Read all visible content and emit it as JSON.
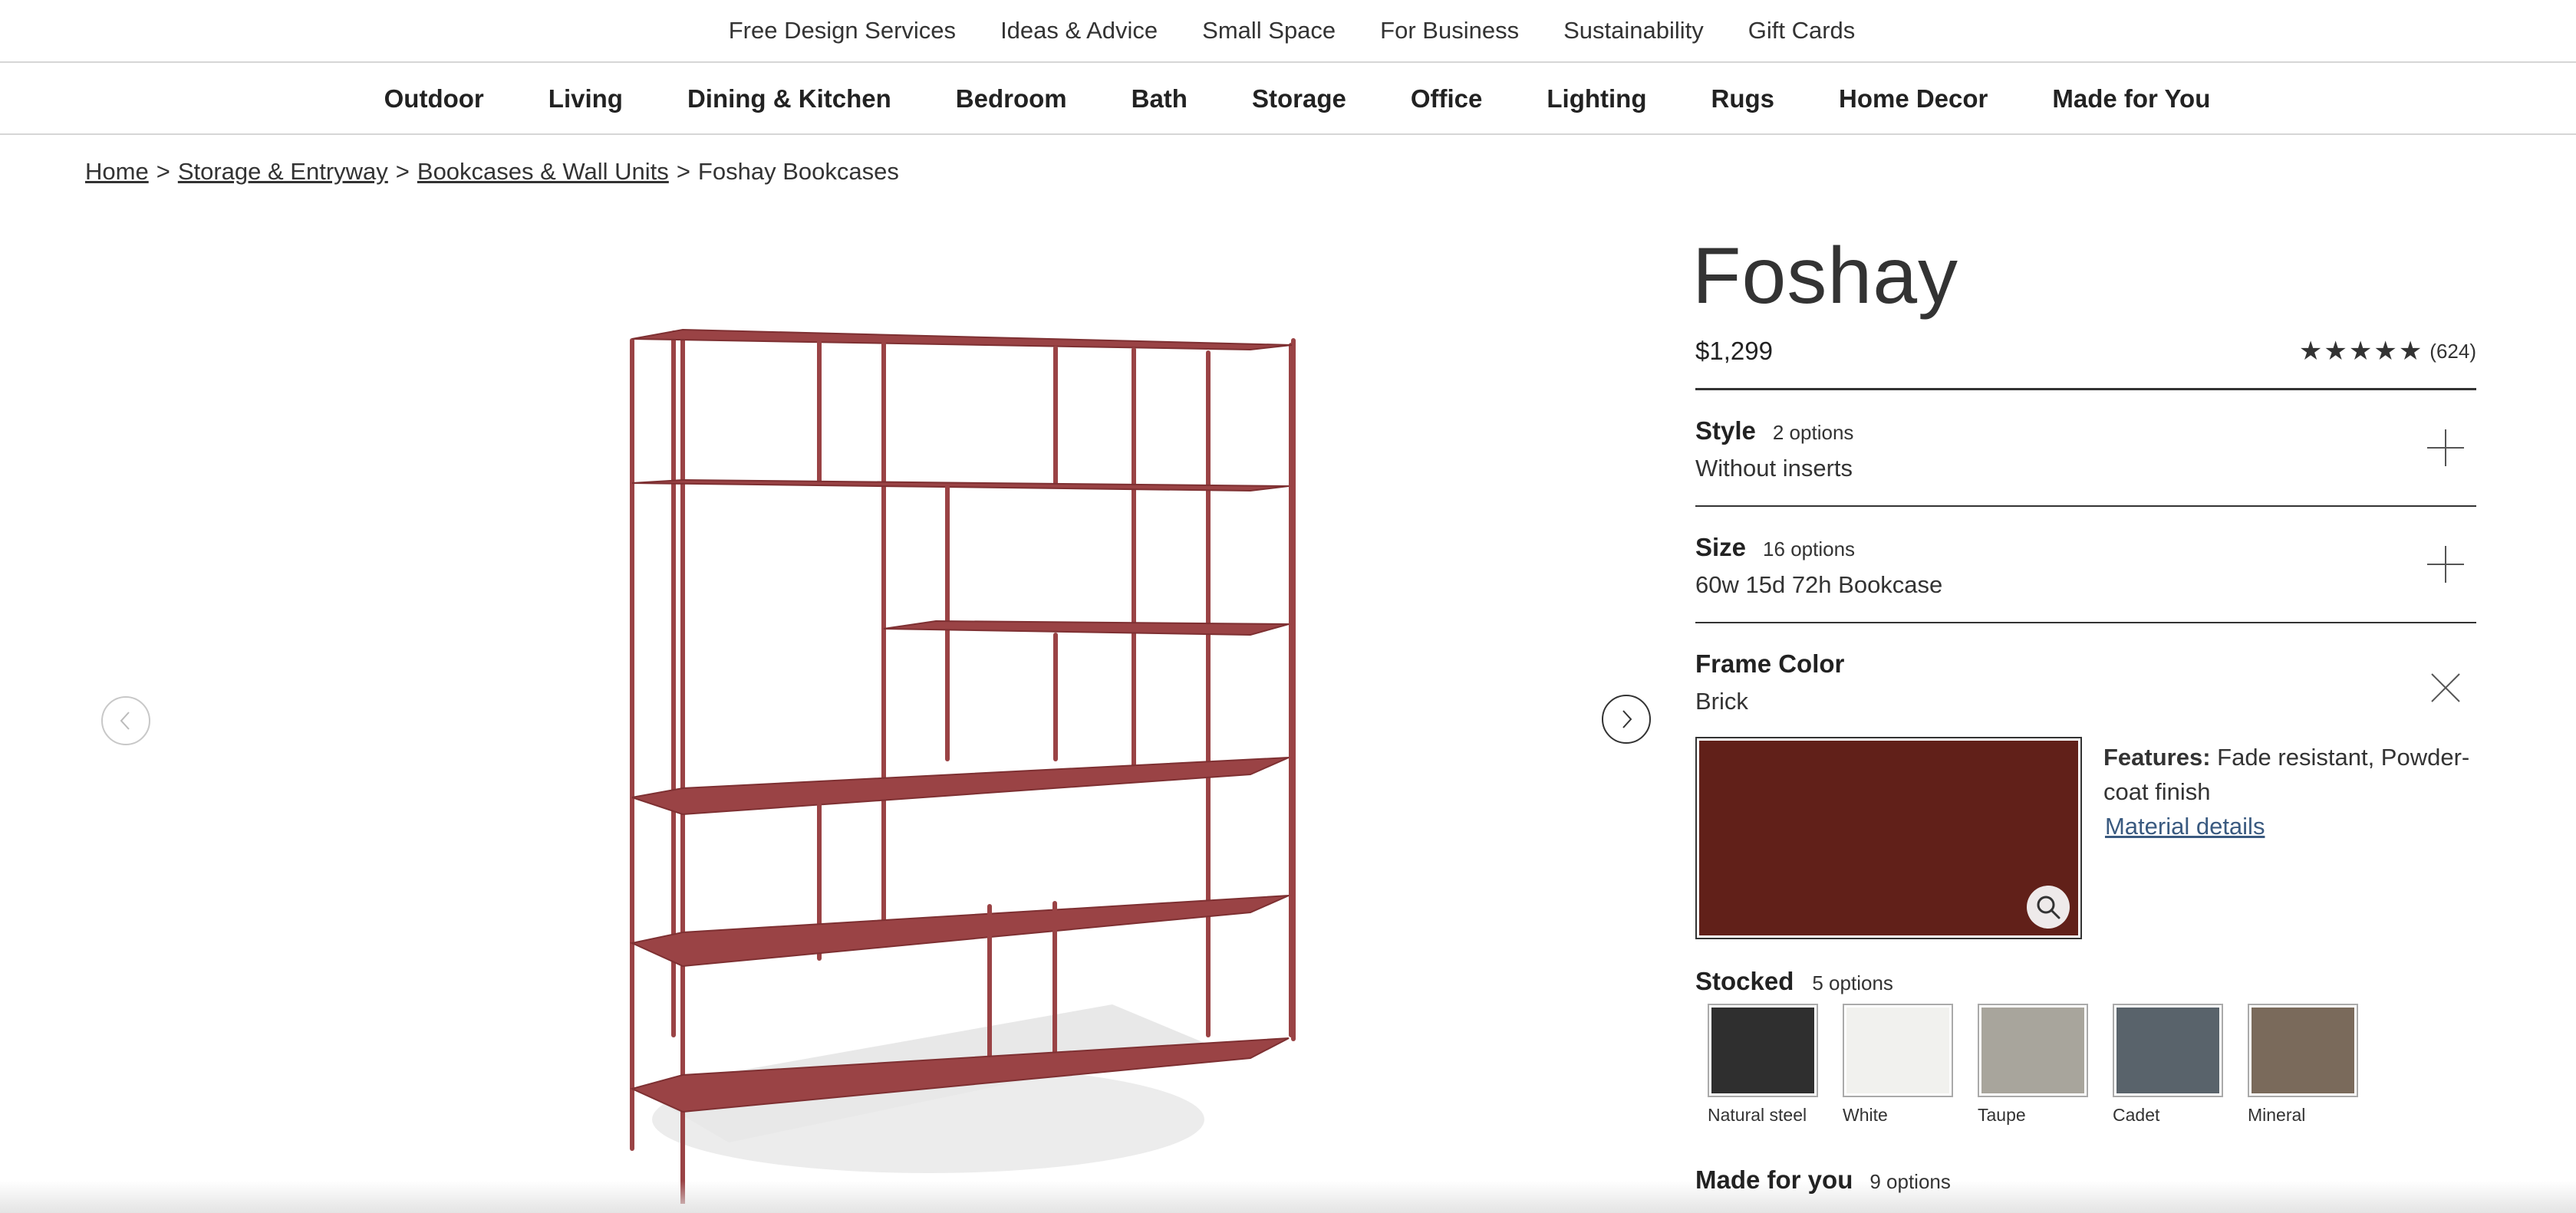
{
  "utility_nav": [
    "Free Design Services",
    "Ideas & Advice",
    "Small Space",
    "For Business",
    "Sustainability",
    "Gift Cards"
  ],
  "main_nav": [
    "Outdoor",
    "Living",
    "Dining & Kitchen",
    "Bedroom",
    "Bath",
    "Storage",
    "Office",
    "Lighting",
    "Rugs",
    "Home Decor",
    "Made for You"
  ],
  "breadcrumb": {
    "links": [
      "Home",
      "Storage & Entryway",
      "Bookcases & Wall Units"
    ],
    "current": "Foshay Bookcases",
    "separator": ">"
  },
  "gallery": {
    "product_color": "#9a4345"
  },
  "product": {
    "title": "Foshay",
    "price": "$1,299",
    "rating_stars": "★★★★★",
    "rating_value": 5,
    "review_count": "(624)"
  },
  "options": {
    "style": {
      "name": "Style",
      "count": "2 options",
      "value": "Without inserts"
    },
    "size": {
      "name": "Size",
      "count": "16 options",
      "value": "60w 15d 72h Bookcase"
    },
    "frame_color": {
      "name": "Frame Color",
      "value": "Brick",
      "swatch_color": "#612019",
      "features_label": "Features:",
      "features_text": "Fade resistant, Powder-coat finish",
      "material_link": "Material details"
    },
    "stocked": {
      "name": "Stocked",
      "count": "5 options",
      "items": [
        {
          "label": "Natural steel",
          "color": "#2f2f2f"
        },
        {
          "label": "White",
          "color": "#f1f1ee"
        },
        {
          "label": "Taupe",
          "color": "#a8a59c"
        },
        {
          "label": "Cadet",
          "color": "#59636b"
        },
        {
          "label": "Mineral",
          "color": "#7a6a5b"
        }
      ]
    },
    "made_for_you": {
      "name": "Made for you",
      "count": "9 options"
    }
  }
}
